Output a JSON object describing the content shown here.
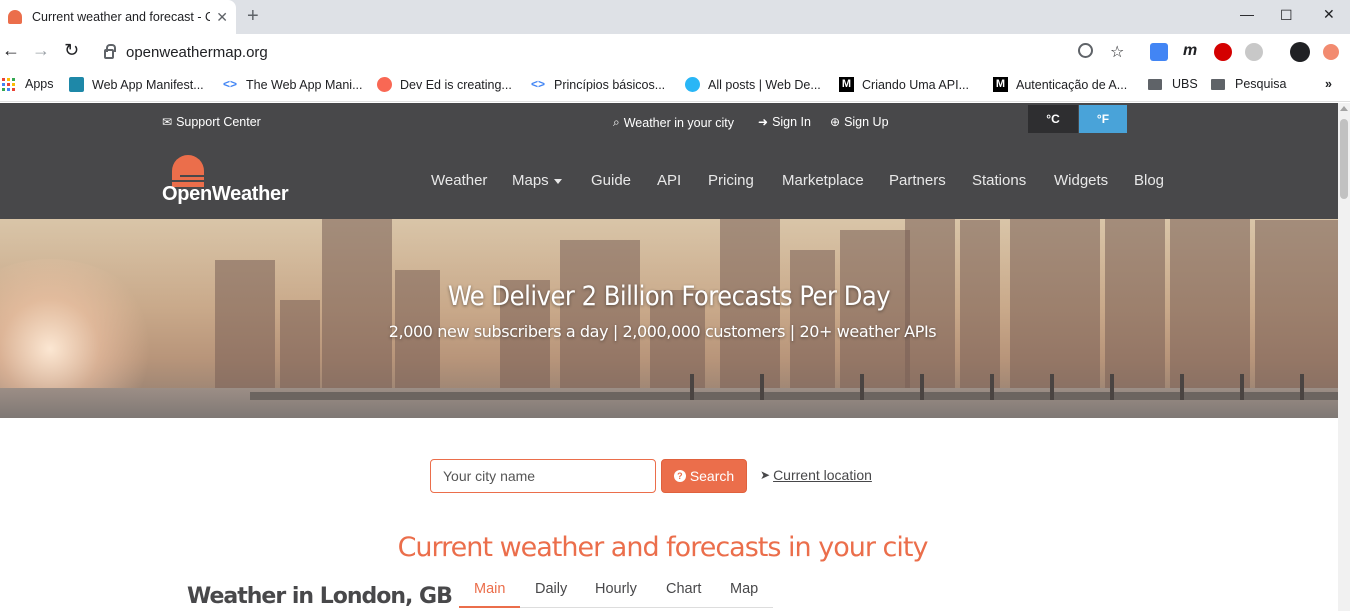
{
  "browser": {
    "tab_title": "Current weather and forecast - OpenWeatherMap",
    "url": "openweathermap.org",
    "bookmarks": [
      {
        "label": "Apps",
        "icon": "apps-grid-icon"
      },
      {
        "label": "Web App Manifest...",
        "icon": "bookmark-site-icon"
      },
      {
        "label": "The Web App Mani...",
        "icon": "code-icon"
      },
      {
        "label": "Dev Ed is creating...",
        "icon": "patreon-icon"
      },
      {
        "label": "Princípios básicos...",
        "icon": "code-icon"
      },
      {
        "label": "All posts | Web De...",
        "icon": "chat-icon"
      },
      {
        "label": "Criando Uma API...",
        "icon": "medium-icon"
      },
      {
        "label": "Autenticação de A...",
        "icon": "medium-icon"
      },
      {
        "label": "UBS",
        "icon": "folder-icon"
      },
      {
        "label": "Pesquisa",
        "icon": "folder-icon"
      }
    ],
    "more_bookmarks": "»"
  },
  "topbar": {
    "support": "Support Center",
    "weather_city": "Weather in your city",
    "sign_in": "Sign In",
    "sign_up": "Sign Up",
    "unit_c": "°C",
    "unit_f": "°F"
  },
  "nav": {
    "logo": "OpenWeather",
    "items": [
      "Weather",
      "Maps",
      "Guide",
      "API",
      "Pricing",
      "Marketplace",
      "Partners",
      "Stations",
      "Widgets",
      "Blog"
    ]
  },
  "hero": {
    "title": "We Deliver 2 Billion Forecasts Per Day",
    "subtitle": "2,000 new subscribers a day | 2,000,000 customers | 20+ weather APIs"
  },
  "search": {
    "placeholder": "Your city name",
    "button": "Search",
    "current_location": "Current location"
  },
  "main": {
    "section_title": "Current weather and forecasts in your city",
    "city_title": "Weather in London, GB",
    "tabs": [
      "Main",
      "Daily",
      "Hourly",
      "Chart",
      "Map"
    ]
  },
  "colors": {
    "accent": "#eb6e4b",
    "dark": "#48484a",
    "unit_active": "#49a3d9"
  }
}
